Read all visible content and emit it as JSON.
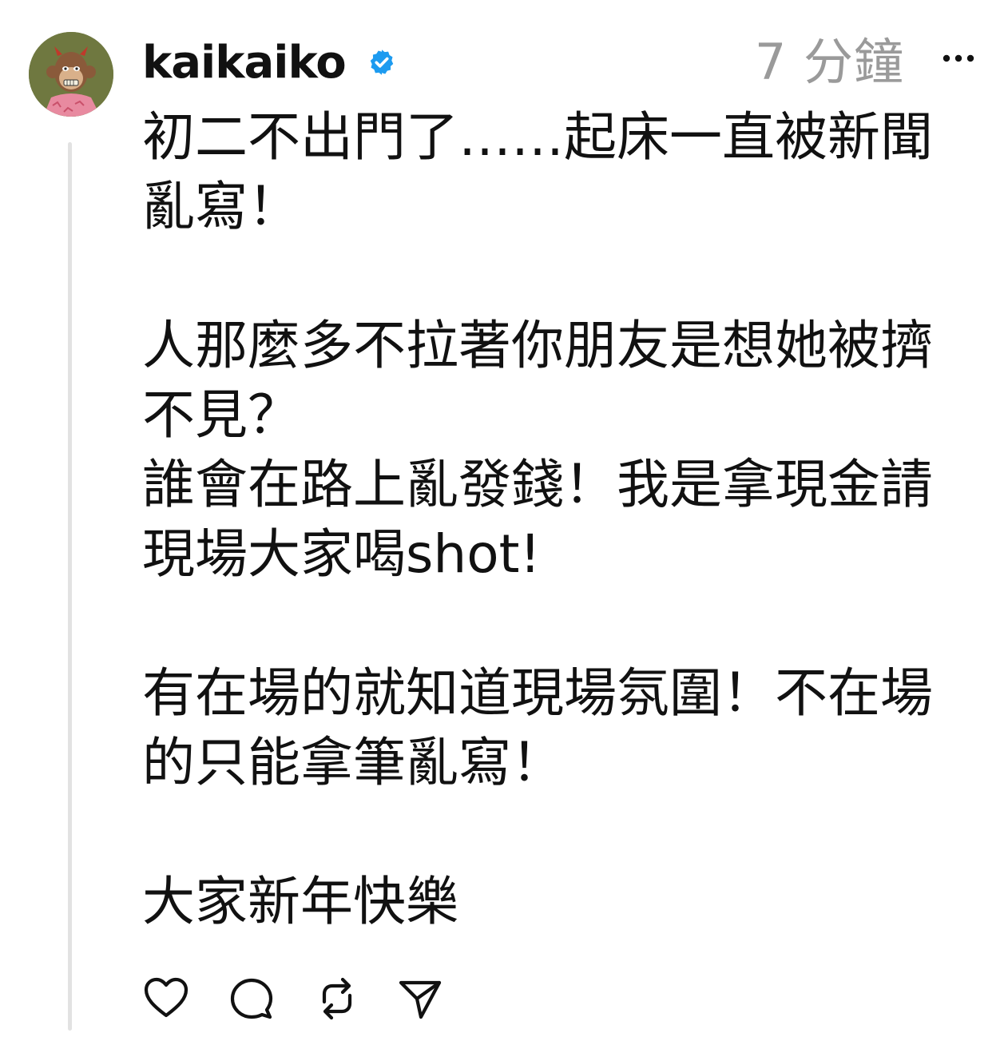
{
  "post": {
    "username": "kaikaiko",
    "verified": true,
    "timestamp": "7 分鐘",
    "avatar_icon": "avatar-ape-icon",
    "paragraphs": [
      "初二不出門了……起床一直被新聞\n亂寫！",
      "人那麼多不拉著你朋友是想她被擠\n不見？\n誰會在路上亂發錢！我是拿現金請\n現場大家喝shot!",
      "有在場的就知道現場氛圍！不在場\n的只能拿筆亂寫！",
      "大家新年快樂"
    ]
  },
  "actions": [
    {
      "name": "like",
      "icon": "heart-icon"
    },
    {
      "name": "reply",
      "icon": "comment-icon"
    },
    {
      "name": "repost",
      "icon": "repost-icon"
    },
    {
      "name": "share",
      "icon": "send-icon"
    }
  ],
  "colors": {
    "text": "#111111",
    "timestamp": "#9a9a9a",
    "verified_badge": "#1d9bf0",
    "thread_line": "#e2e2e2"
  }
}
